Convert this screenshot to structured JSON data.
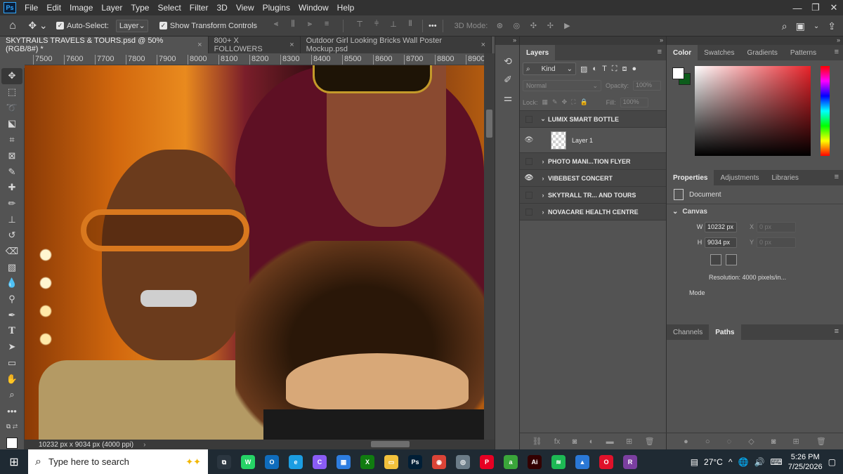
{
  "menu": [
    "File",
    "Edit",
    "Image",
    "Layer",
    "Type",
    "Select",
    "Filter",
    "3D",
    "View",
    "Plugins",
    "Window",
    "Help"
  ],
  "ps_logo": "Ps",
  "options": {
    "auto_select_label": "Auto-Select:",
    "auto_select_value": "Layer",
    "transform_label": "Show Transform Controls",
    "mode_3d": "3D Mode:",
    "more": "•••"
  },
  "tabs": [
    {
      "label": "SKYTRAILS TRAVELS & TOURS.psd @ 50% (RGB/8#) *",
      "active": true
    },
    {
      "label": "800+ X FOLLOWERS",
      "active": false
    },
    {
      "label": "Outdoor Girl Looking Bricks Wall Poster Mockup.psd",
      "active": false
    }
  ],
  "ruler_ticks": [
    "7500",
    "7600",
    "7700",
    "7800",
    "7900",
    "8000",
    "8100",
    "8200",
    "8300",
    "8400",
    "8500",
    "8600",
    "8700",
    "8800",
    "8900"
  ],
  "status": {
    "text": "10232 px x 9034 px (4000 ppi)",
    "arrow": "›"
  },
  "layers_panel": {
    "tab": "Layers",
    "kind": "Kind",
    "blend": "Normal",
    "opacity_label": "Opacity:",
    "opacity_value": "100%",
    "lock_label": "Lock:",
    "fill_label": "Fill:",
    "fill_value": "100%",
    "layers": [
      {
        "name": "LUMIX SMART BOTTLE",
        "type": "group",
        "visible": false,
        "expanded": true
      },
      {
        "name": "Layer 1",
        "type": "layer",
        "visible": true
      },
      {
        "name": "PHOTO MANI...TION FLYER",
        "type": "group",
        "visible": false
      },
      {
        "name": "VIBEBEST CONCERT",
        "type": "group",
        "visible": true
      },
      {
        "name": "SKYTRALL TR... AND TOURS",
        "type": "group",
        "visible": false
      },
      {
        "name": "NOVACARE HEALTH CENTRE",
        "type": "group",
        "visible": false
      }
    ]
  },
  "color_panel": {
    "tabs": [
      "Color",
      "Swatches",
      "Gradients",
      "Patterns"
    ],
    "fg": "#ffffff",
    "bg": "#0d5c1b"
  },
  "properties": {
    "tabs": [
      "Properties",
      "Adjustments",
      "Libraries"
    ],
    "doc_label": "Document",
    "canvas_label": "Canvas",
    "w_label": "W",
    "w_value": "10232 px",
    "h_label": "H",
    "h_value": "9034 px",
    "x_label": "X",
    "x_value": "0 px",
    "y_label": "Y",
    "y_value": "0 px",
    "resolution": "Resolution:  4000 pixels/in...",
    "mode": "Mode"
  },
  "paths_panel": {
    "tabs": [
      "Channels",
      "Paths"
    ]
  },
  "taskbar": {
    "search_placeholder": "Type here to search",
    "temperature": "27°C",
    "time": "5:26 PM",
    "date": "7/25/2026",
    "apps": [
      {
        "name": "task-view",
        "color": "#2b3640",
        "glyph": "⧉"
      },
      {
        "name": "whatsapp",
        "color": "#25d366",
        "glyph": "W"
      },
      {
        "name": "outlook",
        "color": "#0f6cbd",
        "glyph": "O"
      },
      {
        "name": "edge",
        "color": "#1b9de2",
        "glyph": "e"
      },
      {
        "name": "copilot",
        "color": "#8a5cf6",
        "glyph": "C"
      },
      {
        "name": "store",
        "color": "#2d7de0",
        "glyph": "▦"
      },
      {
        "name": "xbox",
        "color": "#107c10",
        "glyph": "X"
      },
      {
        "name": "file-explorer",
        "color": "#f2c13c",
        "glyph": "▭"
      },
      {
        "name": "photoshop",
        "color": "#001e36",
        "glyph": "Ps"
      },
      {
        "name": "chrome",
        "color": "#db4437",
        "glyph": "◉"
      },
      {
        "name": "camera",
        "color": "#6b7c88",
        "glyph": "◎"
      },
      {
        "name": "pinterest",
        "color": "#e60023",
        "glyph": "P"
      },
      {
        "name": "app-green",
        "color": "#3aa63a",
        "glyph": "a"
      },
      {
        "name": "illustrator",
        "color": "#330000",
        "glyph": "Ai"
      },
      {
        "name": "spotify",
        "color": "#1db954",
        "glyph": "≋"
      },
      {
        "name": "photos",
        "color": "#2a78d6",
        "glyph": "▲"
      },
      {
        "name": "opera",
        "color": "#e0112a",
        "glyph": "O"
      },
      {
        "name": "winrar",
        "color": "#7b3fa0",
        "glyph": "R"
      }
    ]
  }
}
